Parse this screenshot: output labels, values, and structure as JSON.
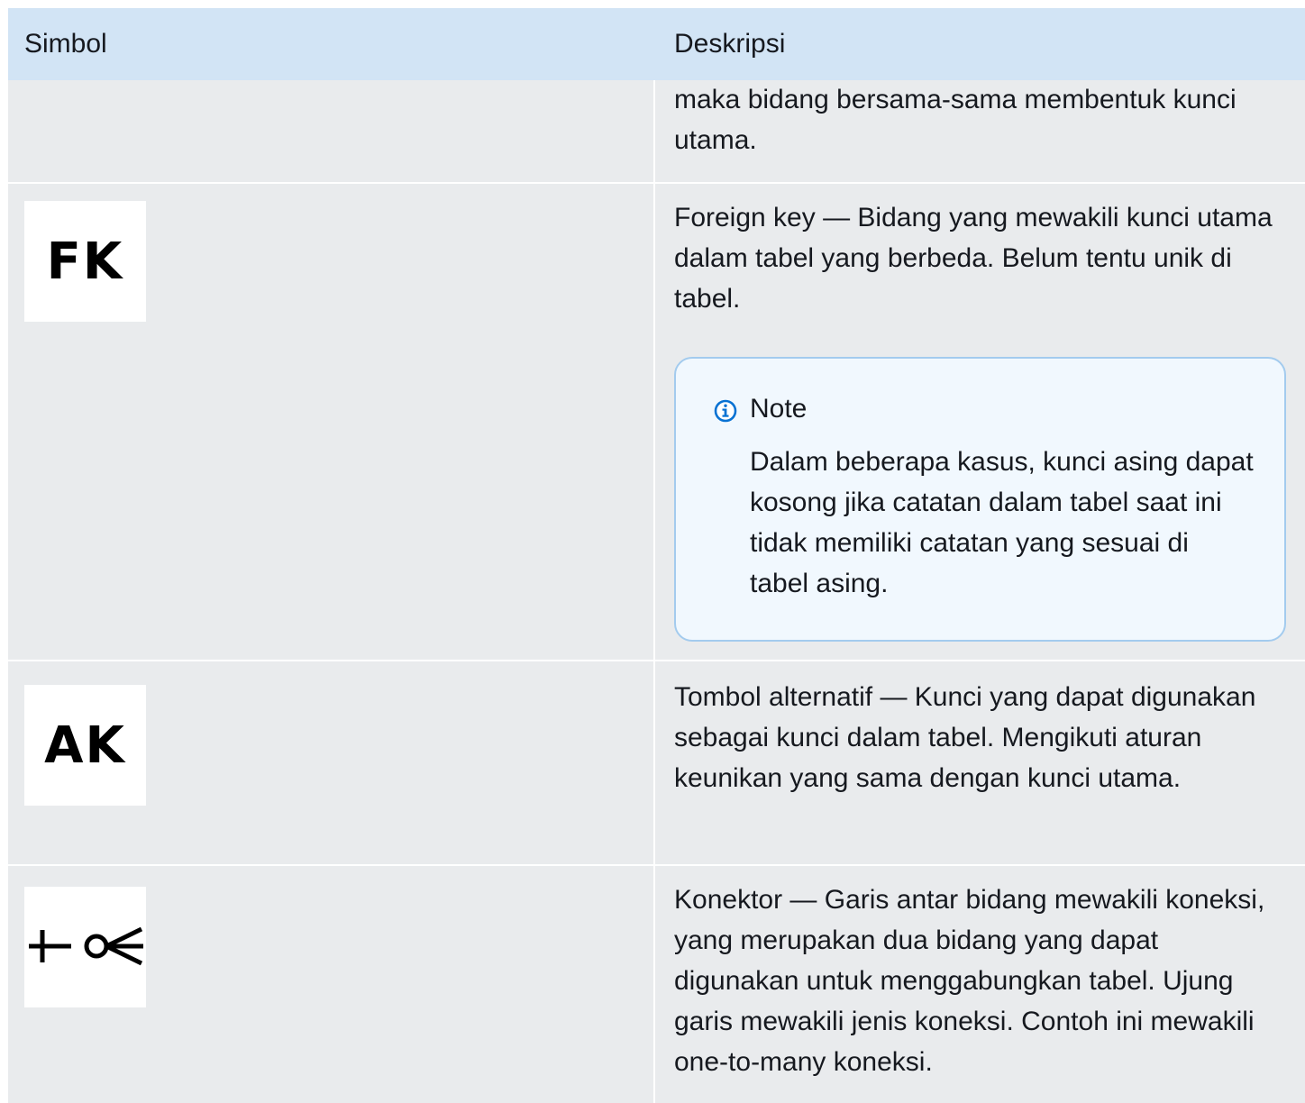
{
  "header": {
    "symbol_label": "Simbol",
    "description_label": "Deskripsi"
  },
  "rows": [
    {
      "symbol": "",
      "description": "maka bidang bersama-sama membentuk kunci utama."
    },
    {
      "symbol": "FK",
      "description": "Foreign key — Bidang yang mewakili kunci utama dalam tabel yang berbeda. Belum tentu unik di tabel.",
      "note": {
        "title": "Note",
        "icon": "info-icon",
        "body": "Dalam beberapa kasus, kunci asing dapat kosong jika catatan dalam tabel saat ini tidak memiliki catatan yang sesuai di tabel asing."
      }
    },
    {
      "symbol": "AK",
      "description": "Tombol alternatif — Kunci yang dapat digunakan sebagai kunci dalam tabel. Mengikuti aturan keunikan yang sama dengan kunci utama."
    },
    {
      "symbol": "connector-one-to-many-icon",
      "description": "Konektor — Garis antar bidang mewakili koneksi, yang merupakan dua bidang yang dapat digunakan untuk menggabungkan tabel. Ujung garis mewakili jenis koneksi. Contoh ini mewakili one-to-many koneksi."
    }
  ],
  "colors": {
    "header_bg": "#d2e4f5",
    "row_bg": "#e9ebed",
    "note_bg": "#f1f8fe",
    "note_border": "#a3cbee",
    "info_icon": "#0972d3"
  }
}
